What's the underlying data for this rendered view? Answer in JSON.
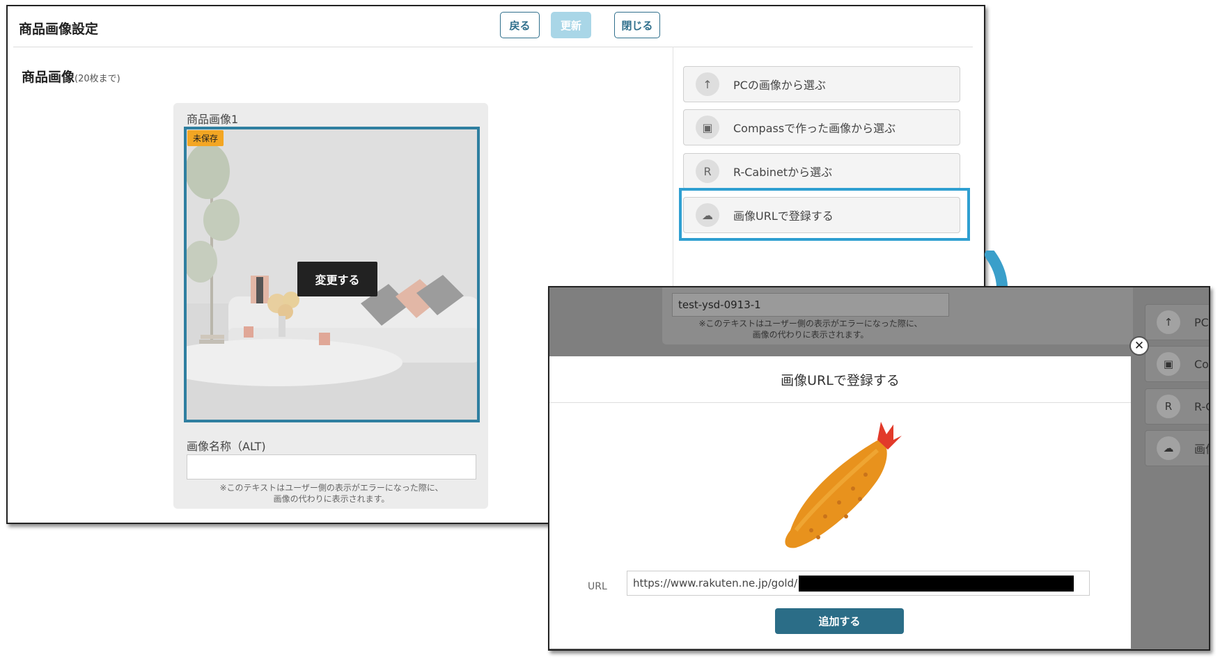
{
  "main": {
    "title": "商品画像設定",
    "back_label": "戻る",
    "update_label": "更新",
    "close_label": "閉じる",
    "section_title": "商品画像",
    "section_limit": "(20枚まで)",
    "card": {
      "label": "商品画像1",
      "badge": "未保存",
      "change_label": "変更する",
      "alt_label": "画像名称（ALT)",
      "alt_value": "",
      "note_line1": "※このテキストはユーザー側の表示がエラーになった際に、",
      "note_line2": "画像の代わりに表示されます。"
    },
    "options": [
      {
        "icon": "arrow-up-icon",
        "glyph": "↑",
        "label": "PCの画像から選ぶ"
      },
      {
        "icon": "image-icon",
        "glyph": "▣",
        "label": "Compassで作った画像から選ぶ"
      },
      {
        "icon": "r-letter-icon",
        "glyph": "R",
        "label": "R-Cabinetから選ぶ"
      },
      {
        "icon": "cloud-icon",
        "glyph": "☁",
        "label": "画像URLで登録する"
      }
    ]
  },
  "modal": {
    "bg_input_value": "test-ysd-0913-1",
    "bg_note_line1": "※このテキストはユーザー側の表示がエラーになった際に、",
    "bg_note_line2": "画像の代わりに表示されます。",
    "bg_side_labels": [
      "PC",
      "Co",
      "R-C",
      "画像"
    ],
    "bg_side_glyphs": [
      "↑",
      "▣",
      "R",
      "☁"
    ],
    "dialog_title": "画像URLで登録する",
    "url_label": "URL",
    "url_value": "https://www.rakuten.ne.jp/gold/",
    "add_label": "追加する",
    "close_glyph": "✕"
  },
  "colors": {
    "accent": "#2f6f8c",
    "highlight": "#2f9fd1",
    "badge": "#f3a623",
    "add_button": "#2b6d87"
  }
}
